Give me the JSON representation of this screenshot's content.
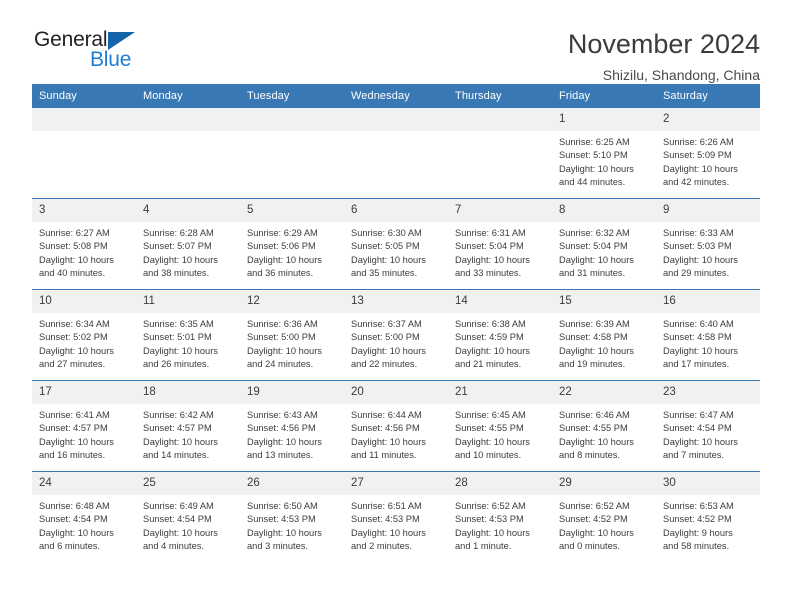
{
  "logo": {
    "word_top": "General",
    "word_bottom": "Blue",
    "triangle_icon": "triangle-icon",
    "color_dark": "#231f20",
    "color_blue": "#1d7fd4"
  },
  "header": {
    "title": "November 2024",
    "subtitle": "Shizilu, Shandong, China"
  },
  "theme": {
    "header_bg": "#3878b4",
    "daynum_bg": "#f1f1f1",
    "row_border": "#3878b4",
    "text": "#3c3c3c"
  },
  "calendar": {
    "weekday_headers": [
      "Sunday",
      "Monday",
      "Tuesday",
      "Wednesday",
      "Thursday",
      "Friday",
      "Saturday"
    ],
    "weeks": [
      [
        {
          "day": "",
          "sunrise": "",
          "sunset": "",
          "daylight1": "",
          "daylight2": "",
          "empty": true
        },
        {
          "day": "",
          "sunrise": "",
          "sunset": "",
          "daylight1": "",
          "daylight2": "",
          "empty": true
        },
        {
          "day": "",
          "sunrise": "",
          "sunset": "",
          "daylight1": "",
          "daylight2": "",
          "empty": true
        },
        {
          "day": "",
          "sunrise": "",
          "sunset": "",
          "daylight1": "",
          "daylight2": "",
          "empty": true
        },
        {
          "day": "",
          "sunrise": "",
          "sunset": "",
          "daylight1": "",
          "daylight2": "",
          "empty": true
        },
        {
          "day": "1",
          "sunrise": "Sunrise: 6:25 AM",
          "sunset": "Sunset: 5:10 PM",
          "daylight1": "Daylight: 10 hours",
          "daylight2": "and 44 minutes.",
          "empty": false
        },
        {
          "day": "2",
          "sunrise": "Sunrise: 6:26 AM",
          "sunset": "Sunset: 5:09 PM",
          "daylight1": "Daylight: 10 hours",
          "daylight2": "and 42 minutes.",
          "empty": false
        }
      ],
      [
        {
          "day": "3",
          "sunrise": "Sunrise: 6:27 AM",
          "sunset": "Sunset: 5:08 PM",
          "daylight1": "Daylight: 10 hours",
          "daylight2": "and 40 minutes.",
          "empty": false
        },
        {
          "day": "4",
          "sunrise": "Sunrise: 6:28 AM",
          "sunset": "Sunset: 5:07 PM",
          "daylight1": "Daylight: 10 hours",
          "daylight2": "and 38 minutes.",
          "empty": false
        },
        {
          "day": "5",
          "sunrise": "Sunrise: 6:29 AM",
          "sunset": "Sunset: 5:06 PM",
          "daylight1": "Daylight: 10 hours",
          "daylight2": "and 36 minutes.",
          "empty": false
        },
        {
          "day": "6",
          "sunrise": "Sunrise: 6:30 AM",
          "sunset": "Sunset: 5:05 PM",
          "daylight1": "Daylight: 10 hours",
          "daylight2": "and 35 minutes.",
          "empty": false
        },
        {
          "day": "7",
          "sunrise": "Sunrise: 6:31 AM",
          "sunset": "Sunset: 5:04 PM",
          "daylight1": "Daylight: 10 hours",
          "daylight2": "and 33 minutes.",
          "empty": false
        },
        {
          "day": "8",
          "sunrise": "Sunrise: 6:32 AM",
          "sunset": "Sunset: 5:04 PM",
          "daylight1": "Daylight: 10 hours",
          "daylight2": "and 31 minutes.",
          "empty": false
        },
        {
          "day": "9",
          "sunrise": "Sunrise: 6:33 AM",
          "sunset": "Sunset: 5:03 PM",
          "daylight1": "Daylight: 10 hours",
          "daylight2": "and 29 minutes.",
          "empty": false
        }
      ],
      [
        {
          "day": "10",
          "sunrise": "Sunrise: 6:34 AM",
          "sunset": "Sunset: 5:02 PM",
          "daylight1": "Daylight: 10 hours",
          "daylight2": "and 27 minutes.",
          "empty": false
        },
        {
          "day": "11",
          "sunrise": "Sunrise: 6:35 AM",
          "sunset": "Sunset: 5:01 PM",
          "daylight1": "Daylight: 10 hours",
          "daylight2": "and 26 minutes.",
          "empty": false
        },
        {
          "day": "12",
          "sunrise": "Sunrise: 6:36 AM",
          "sunset": "Sunset: 5:00 PM",
          "daylight1": "Daylight: 10 hours",
          "daylight2": "and 24 minutes.",
          "empty": false
        },
        {
          "day": "13",
          "sunrise": "Sunrise: 6:37 AM",
          "sunset": "Sunset: 5:00 PM",
          "daylight1": "Daylight: 10 hours",
          "daylight2": "and 22 minutes.",
          "empty": false
        },
        {
          "day": "14",
          "sunrise": "Sunrise: 6:38 AM",
          "sunset": "Sunset: 4:59 PM",
          "daylight1": "Daylight: 10 hours",
          "daylight2": "and 21 minutes.",
          "empty": false
        },
        {
          "day": "15",
          "sunrise": "Sunrise: 6:39 AM",
          "sunset": "Sunset: 4:58 PM",
          "daylight1": "Daylight: 10 hours",
          "daylight2": "and 19 minutes.",
          "empty": false
        },
        {
          "day": "16",
          "sunrise": "Sunrise: 6:40 AM",
          "sunset": "Sunset: 4:58 PM",
          "daylight1": "Daylight: 10 hours",
          "daylight2": "and 17 minutes.",
          "empty": false
        }
      ],
      [
        {
          "day": "17",
          "sunrise": "Sunrise: 6:41 AM",
          "sunset": "Sunset: 4:57 PM",
          "daylight1": "Daylight: 10 hours",
          "daylight2": "and 16 minutes.",
          "empty": false
        },
        {
          "day": "18",
          "sunrise": "Sunrise: 6:42 AM",
          "sunset": "Sunset: 4:57 PM",
          "daylight1": "Daylight: 10 hours",
          "daylight2": "and 14 minutes.",
          "empty": false
        },
        {
          "day": "19",
          "sunrise": "Sunrise: 6:43 AM",
          "sunset": "Sunset: 4:56 PM",
          "daylight1": "Daylight: 10 hours",
          "daylight2": "and 13 minutes.",
          "empty": false
        },
        {
          "day": "20",
          "sunrise": "Sunrise: 6:44 AM",
          "sunset": "Sunset: 4:56 PM",
          "daylight1": "Daylight: 10 hours",
          "daylight2": "and 11 minutes.",
          "empty": false
        },
        {
          "day": "21",
          "sunrise": "Sunrise: 6:45 AM",
          "sunset": "Sunset: 4:55 PM",
          "daylight1": "Daylight: 10 hours",
          "daylight2": "and 10 minutes.",
          "empty": false
        },
        {
          "day": "22",
          "sunrise": "Sunrise: 6:46 AM",
          "sunset": "Sunset: 4:55 PM",
          "daylight1": "Daylight: 10 hours",
          "daylight2": "and 8 minutes.",
          "empty": false
        },
        {
          "day": "23",
          "sunrise": "Sunrise: 6:47 AM",
          "sunset": "Sunset: 4:54 PM",
          "daylight1": "Daylight: 10 hours",
          "daylight2": "and 7 minutes.",
          "empty": false
        }
      ],
      [
        {
          "day": "24",
          "sunrise": "Sunrise: 6:48 AM",
          "sunset": "Sunset: 4:54 PM",
          "daylight1": "Daylight: 10 hours",
          "daylight2": "and 6 minutes.",
          "empty": false
        },
        {
          "day": "25",
          "sunrise": "Sunrise: 6:49 AM",
          "sunset": "Sunset: 4:54 PM",
          "daylight1": "Daylight: 10 hours",
          "daylight2": "and 4 minutes.",
          "empty": false
        },
        {
          "day": "26",
          "sunrise": "Sunrise: 6:50 AM",
          "sunset": "Sunset: 4:53 PM",
          "daylight1": "Daylight: 10 hours",
          "daylight2": "and 3 minutes.",
          "empty": false
        },
        {
          "day": "27",
          "sunrise": "Sunrise: 6:51 AM",
          "sunset": "Sunset: 4:53 PM",
          "daylight1": "Daylight: 10 hours",
          "daylight2": "and 2 minutes.",
          "empty": false
        },
        {
          "day": "28",
          "sunrise": "Sunrise: 6:52 AM",
          "sunset": "Sunset: 4:53 PM",
          "daylight1": "Daylight: 10 hours",
          "daylight2": "and 1 minute.",
          "empty": false
        },
        {
          "day": "29",
          "sunrise": "Sunrise: 6:52 AM",
          "sunset": "Sunset: 4:52 PM",
          "daylight1": "Daylight: 10 hours",
          "daylight2": "and 0 minutes.",
          "empty": false
        },
        {
          "day": "30",
          "sunrise": "Sunrise: 6:53 AM",
          "sunset": "Sunset: 4:52 PM",
          "daylight1": "Daylight: 9 hours",
          "daylight2": "and 58 minutes.",
          "empty": false
        }
      ]
    ]
  }
}
